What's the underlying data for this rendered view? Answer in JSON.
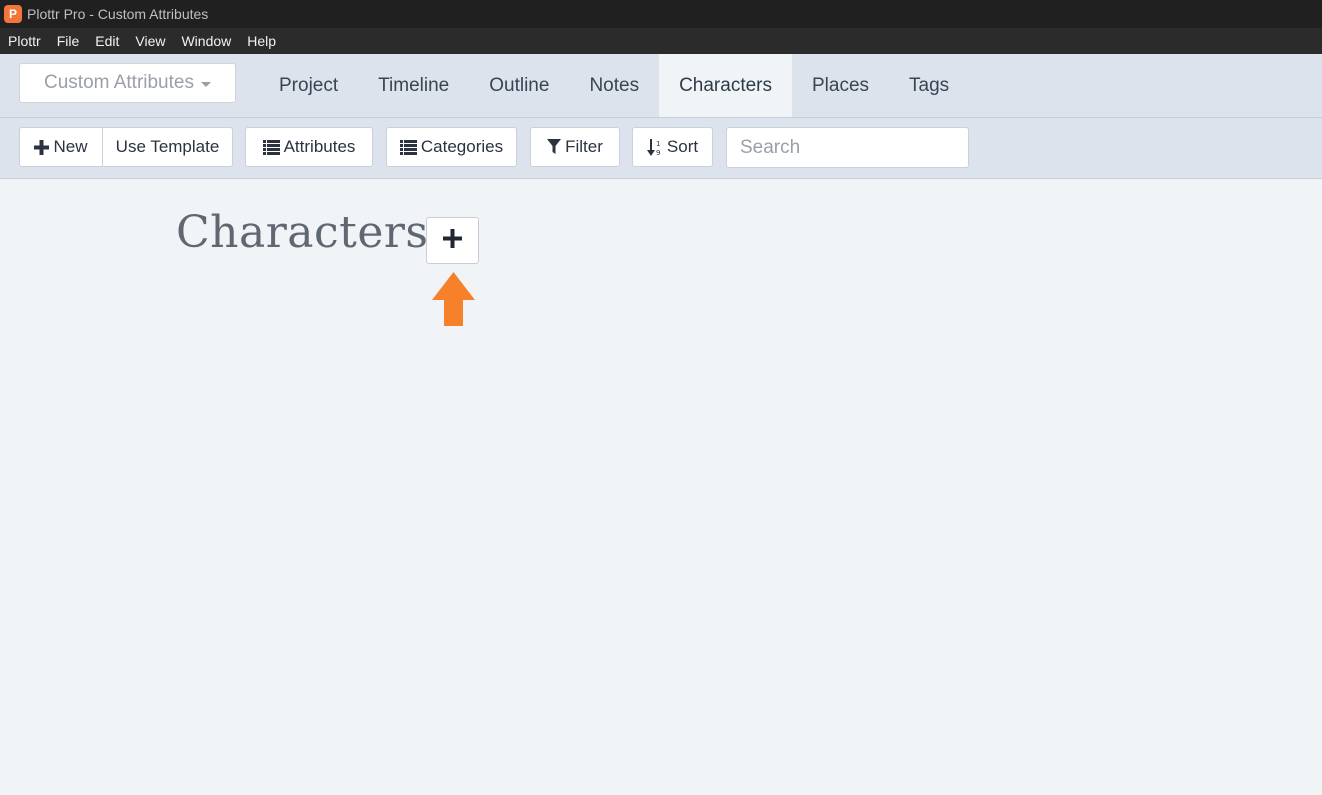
{
  "window": {
    "title": "Plottr Pro - Custom Attributes",
    "app_icon_glyph": "P"
  },
  "menubar": {
    "items": [
      "Plottr",
      "File",
      "Edit",
      "View",
      "Window",
      "Help"
    ]
  },
  "navbar": {
    "project_dropdown": "Custom Attributes",
    "tabs": [
      "Project",
      "Timeline",
      "Outline",
      "Notes",
      "Characters",
      "Places",
      "Tags"
    ],
    "active_tab": "Characters"
  },
  "toolbar": {
    "new_label": "New",
    "use_template_label": "Use Template",
    "attributes_label": "Attributes",
    "categories_label": "Categories",
    "filter_label": "Filter",
    "sort_label": "Sort",
    "search_placeholder": "Search"
  },
  "main": {
    "heading": "Characters"
  },
  "colors": {
    "accent_arrow": "#f7812a",
    "navbar_bg": "#dde3ed",
    "content_bg": "#f0f4f7"
  }
}
